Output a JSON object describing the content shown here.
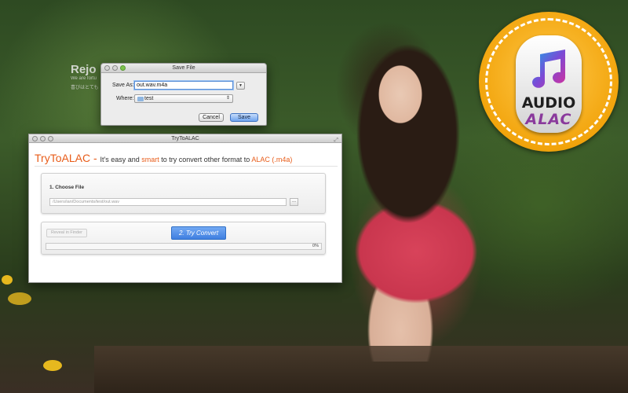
{
  "background": {
    "promo_title": "Rejo",
    "promo_line1": "We are fortu",
    "promo_line2": "喜びはとても"
  },
  "badge": {
    "icon": "music-note-icon",
    "audio_label": "AUDIO",
    "alac_label": "ALAC",
    "color_outer": "#f2a40c",
    "color_alac": "#8a3a9c"
  },
  "save_dialog": {
    "title": "Save File",
    "save_as_label": "Save As:",
    "save_as_value": "out.wav.m4a",
    "where_label": "Where:",
    "where_value": "test",
    "cancel_label": "Cancel",
    "save_label": "Save"
  },
  "app": {
    "title": "TryToALAC",
    "headline": {
      "brand": "TryToALAC",
      "dash": " - ",
      "part1": "It's easy and ",
      "smart": "smart",
      "part2": " to try convert other format to ",
      "alac": "ALAC (.m4a)"
    },
    "choose_file": {
      "title": "1. Choose File",
      "path": "/Users/ian/Documents/test/out.wav",
      "browse_label": "..."
    },
    "reveal_label": "Reveal in Finder",
    "convert_label": "2. Try Convert",
    "progress_value": 0,
    "progress_text": "0%",
    "accent_color": "#e85c19"
  }
}
